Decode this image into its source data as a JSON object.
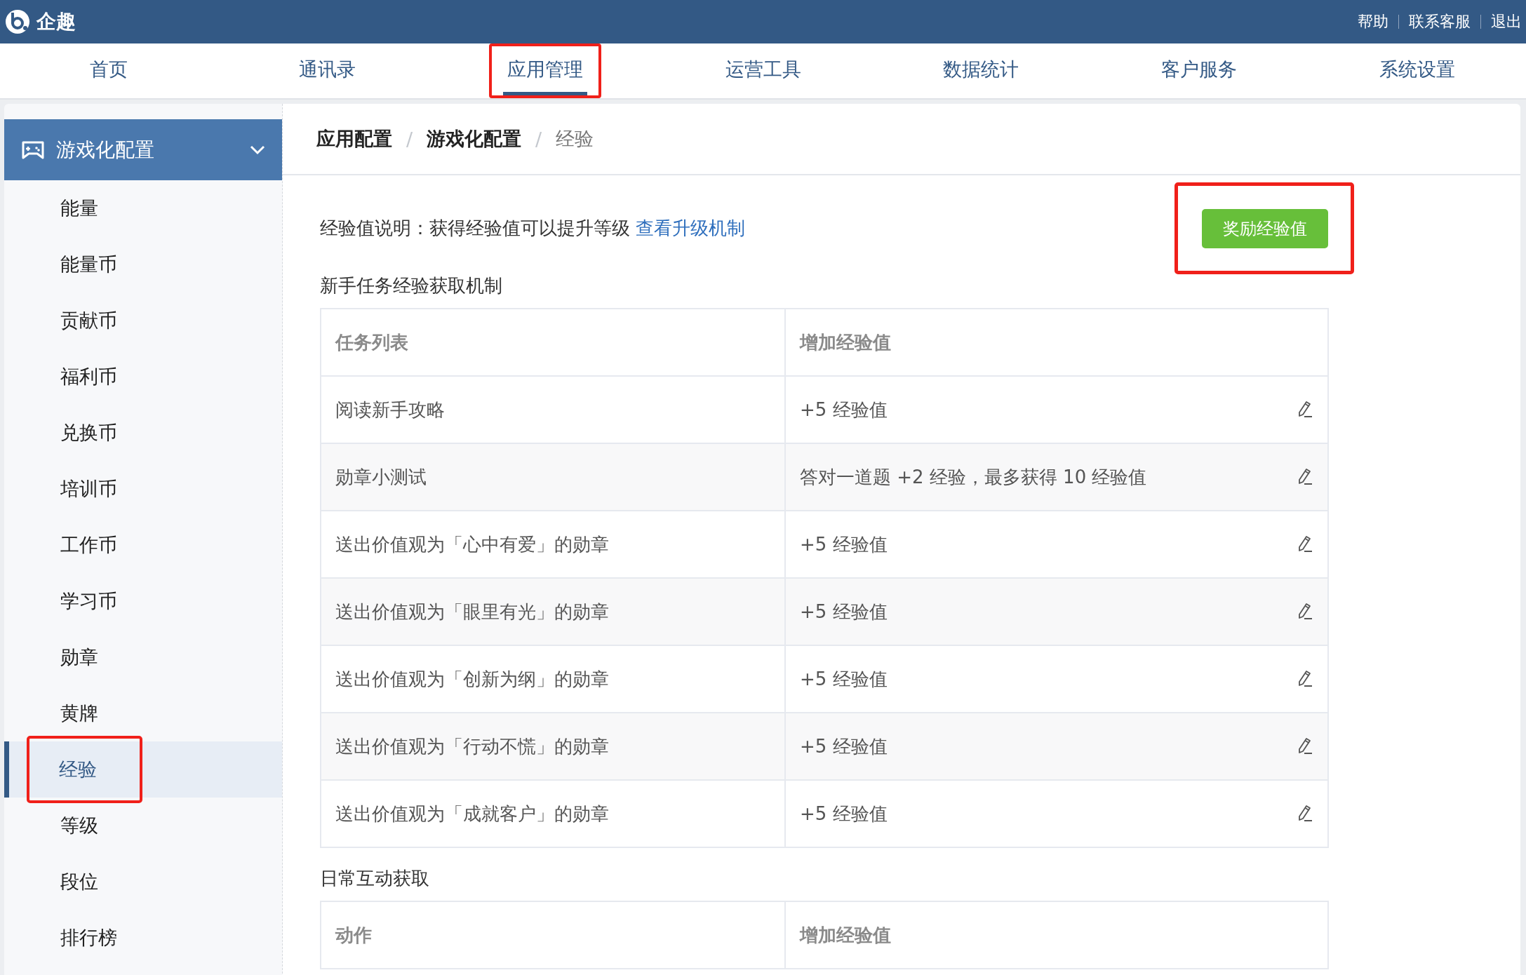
{
  "header": {
    "logo_text": "企趣",
    "links": [
      "帮助",
      "联系客服",
      "退出"
    ]
  },
  "nav_tabs": [
    {
      "label": "首页",
      "selected": false,
      "annotated": false
    },
    {
      "label": "通讯录",
      "selected": false,
      "annotated": false
    },
    {
      "label": "应用管理",
      "selected": true,
      "annotated": true
    },
    {
      "label": "运营工具",
      "selected": false,
      "annotated": false
    },
    {
      "label": "数据统计",
      "selected": false,
      "annotated": false
    },
    {
      "label": "客户服务",
      "selected": false,
      "annotated": false
    },
    {
      "label": "系统设置",
      "selected": false,
      "annotated": false
    }
  ],
  "sidebar": {
    "group": {
      "label": "游戏化配置",
      "expanded": true
    },
    "items": [
      {
        "label": "能量",
        "selected": false,
        "annotated": false
      },
      {
        "label": "能量币",
        "selected": false,
        "annotated": false
      },
      {
        "label": "贡献币",
        "selected": false,
        "annotated": false
      },
      {
        "label": "福利币",
        "selected": false,
        "annotated": false
      },
      {
        "label": "兑换币",
        "selected": false,
        "annotated": false
      },
      {
        "label": "培训币",
        "selected": false,
        "annotated": false
      },
      {
        "label": "工作币",
        "selected": false,
        "annotated": false
      },
      {
        "label": "学习币",
        "selected": false,
        "annotated": false
      },
      {
        "label": "勋章",
        "selected": false,
        "annotated": false
      },
      {
        "label": "黄牌",
        "selected": false,
        "annotated": false
      },
      {
        "label": "经验",
        "selected": true,
        "annotated": true
      },
      {
        "label": "等级",
        "selected": false,
        "annotated": false
      },
      {
        "label": "段位",
        "selected": false,
        "annotated": false
      },
      {
        "label": "排行榜",
        "selected": false,
        "annotated": false
      }
    ]
  },
  "breadcrumb": [
    "应用配置",
    "游戏化配置",
    "经验"
  ],
  "breadcrumb_separator": "/",
  "description": {
    "text": "经验值说明：获得经验值可以提升等级",
    "link": "查看升级机制"
  },
  "reward_button": {
    "label": "奖励经验值",
    "annotated": true
  },
  "sections": [
    {
      "title": "新手任务经验获取机制",
      "columns": [
        "任务列表",
        "增加经验值"
      ],
      "rows": [
        [
          "阅读新手攻略",
          "+5 经验值"
        ],
        [
          "勋章小测试",
          "答对一道题 +2 经验，最多获得 10 经验值"
        ],
        [
          "送出价值观为「心中有爱」的勋章",
          "+5 经验值"
        ],
        [
          "送出价值观为「眼里有光」的勋章",
          "+5 经验值"
        ],
        [
          "送出价值观为「创新为纲」的勋章",
          "+5 经验值"
        ],
        [
          "送出价值观为「行动不慌」的勋章",
          "+5 经验值"
        ],
        [
          "送出价值观为「成就客户」的勋章",
          "+5 经验值"
        ]
      ]
    },
    {
      "title": "日常互动获取",
      "columns": [
        "动作",
        "增加经验值"
      ]
    }
  ]
}
